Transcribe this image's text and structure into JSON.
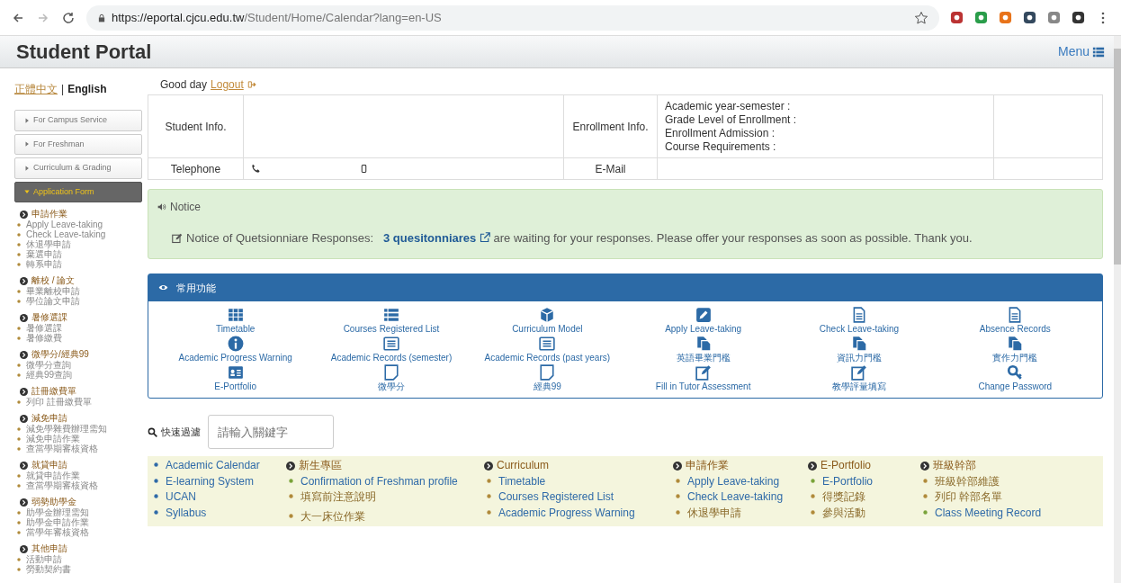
{
  "browser": {
    "url_host": "https://eportal.cjcu.edu.tw",
    "url_path": "/Student/Home/Calendar?lang=en-US"
  },
  "header": {
    "title": "Student Portal",
    "menu": "Menu"
  },
  "greeting": {
    "text": "Good day",
    "logout": "Logout"
  },
  "language_separator": "|",
  "languages": [
    {
      "label": "正體中文",
      "selected": false
    },
    {
      "label": "English",
      "selected": true
    }
  ],
  "sidebar": {
    "sections": [
      {
        "label": "For Campus Service",
        "expanded": false
      },
      {
        "label": "For Freshman",
        "expanded": false
      },
      {
        "label": "Curriculum & Grading",
        "expanded": false
      },
      {
        "label": "Application Form",
        "expanded": true
      }
    ],
    "groups": [
      {
        "heading": "申請作業",
        "items": [
          "Apply Leave-taking",
          "Check Leave-taking",
          "休退學申請",
          "棄選申請",
          "轉系申請"
        ]
      },
      {
        "heading": "離校 / 論文",
        "items": [
          "畢業離校申請",
          "學位論文申請"
        ]
      },
      {
        "heading": "暑修選課",
        "items": [
          "暑修選課",
          "暑修繳費"
        ]
      },
      {
        "heading": "微學分/經典99",
        "items": [
          "微學分查詢",
          "經典99查詢"
        ]
      },
      {
        "heading": "註冊繳費單",
        "items": [
          "列印 註冊繳費單"
        ]
      },
      {
        "heading": "減免申請",
        "items": [
          "減免學雜費辦理需知",
          "減免申請作業",
          "查當學期審核資格"
        ]
      },
      {
        "heading": "就貸申請",
        "items": [
          "就貸申請作業",
          "查當學期審核資格"
        ]
      },
      {
        "heading": "弱勢助學金",
        "items": [
          "助學金辦理需知",
          "助學金申請作業",
          "當學年審核資格"
        ]
      },
      {
        "heading": "其他申請",
        "items": [
          "活動申請",
          "勞動契約書"
        ]
      }
    ]
  },
  "info_table": {
    "student_label": "Student Info.",
    "enrollment_label": "Enrollment Info.",
    "enrollment_lines": [
      "Academic year-semester :",
      "Grade Level of Enrollment :",
      "Enrollment Admission :",
      "Course Requirements :"
    ],
    "telephone_label": "Telephone",
    "email_label": "E-Mail"
  },
  "notice": {
    "title": "Notice",
    "lead": "Notice of Quetsionniare Responses:",
    "link": "3 quesitonniares",
    "rest": "are waiting for your responses. Please offer your responses as soon as possible. Thank you."
  },
  "shortcuts": {
    "title": "常用功能",
    "items": [
      {
        "label": "Timetable",
        "kind": "table"
      },
      {
        "label": "Courses Registered List",
        "kind": "list"
      },
      {
        "label": "Curriculum Model",
        "kind": "cube"
      },
      {
        "label": "Apply Leave-taking",
        "kind": "pencil"
      },
      {
        "label": "Check Leave-taking",
        "kind": "doc"
      },
      {
        "label": "Absence Records",
        "kind": "doc"
      },
      {
        "label": "Academic Progress Warning",
        "kind": "info"
      },
      {
        "label": "Academic Records (semester)",
        "kind": "listbox"
      },
      {
        "label": "Academic Records (past years)",
        "kind": "listbox"
      },
      {
        "label": "英語畢業門檻",
        "kind": "files"
      },
      {
        "label": "資訊力門檻",
        "kind": "files"
      },
      {
        "label": "實作力門檻",
        "kind": "files"
      },
      {
        "label": "E-Portfolio",
        "kind": "card"
      },
      {
        "label": "微學分",
        "kind": "square"
      },
      {
        "label": "經典99",
        "kind": "square"
      },
      {
        "label": "Fill in Tutor Assessment",
        "kind": "edit"
      },
      {
        "label": "教學評量填寫",
        "kind": "edit"
      },
      {
        "label": "Change Password",
        "kind": "key"
      }
    ]
  },
  "filter": {
    "label": "快速過濾",
    "placeholder": "請輸入關鍵字"
  },
  "links": [
    {
      "items": [
        "Academic Calendar",
        "E-learning System",
        "UCAN",
        "Syllabus"
      ]
    },
    {
      "heading": "新生專區",
      "items": [
        "Confirmation of Freshman profile",
        "填寫前注意說明",
        "大一床位作業"
      ]
    },
    {
      "heading": "Curriculum",
      "items": [
        "Timetable",
        "Courses Registered List",
        "Academic Progress Warning"
      ]
    },
    {
      "heading": "申請作業",
      "items": [
        "Apply Leave-taking",
        "Check Leave-taking",
        "休退學申請"
      ]
    },
    {
      "heading": "E-Portfolio",
      "items": [
        "E-Portfolio",
        "得獎記錄",
        "參與活動"
      ]
    },
    {
      "heading": "班級幹部",
      "items": [
        "班級幹部維護",
        "列印 幹部名單",
        "Class Meeting Record"
      ]
    }
  ]
}
